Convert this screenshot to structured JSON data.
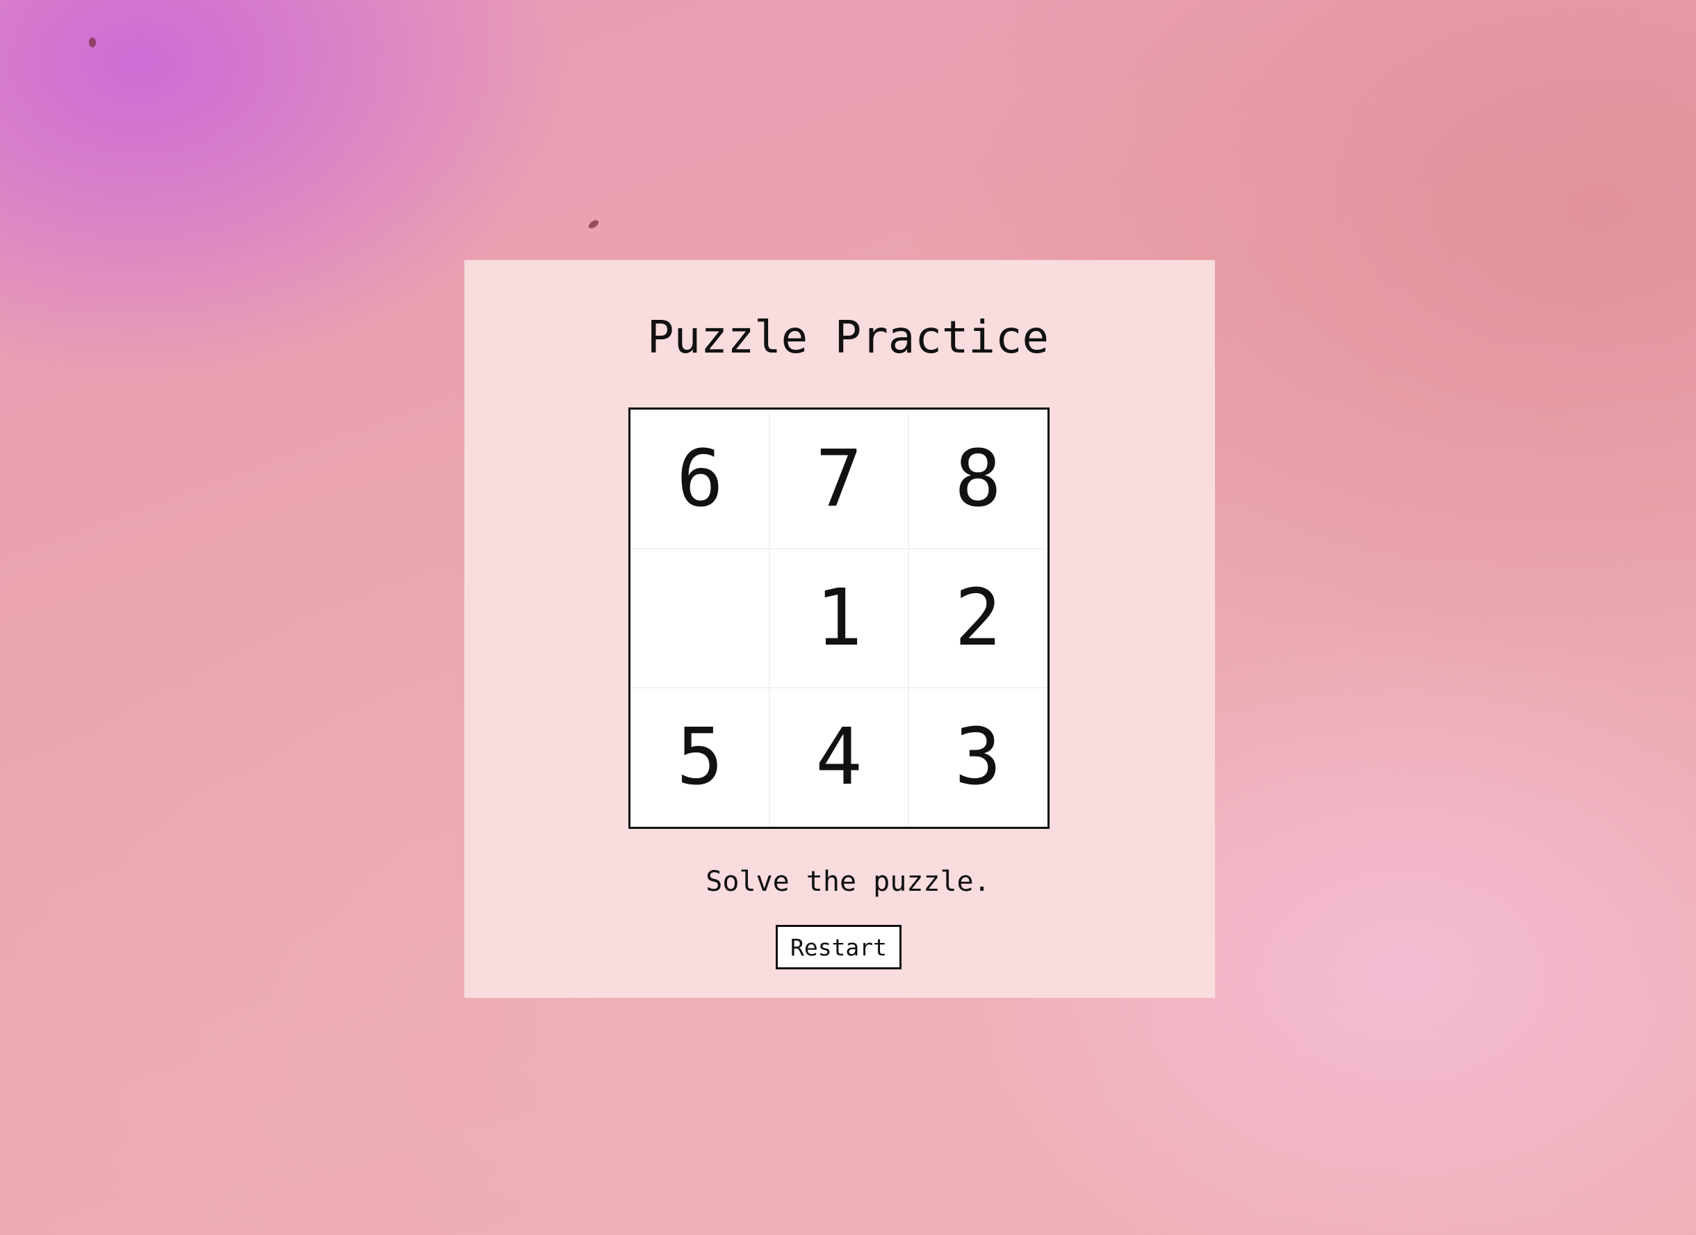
{
  "colors": {
    "panel_background": "#f9dcdd",
    "board_background": "#ffffff",
    "text": "#111111"
  },
  "game": {
    "title": "Puzzle Practice",
    "board": {
      "rows": 3,
      "cols": 3,
      "tiles": [
        "6",
        "7",
        "8",
        "",
        "1",
        "2",
        "5",
        "4",
        "3"
      ]
    },
    "status": "Solve the puzzle.",
    "restart_label": "Restart"
  }
}
